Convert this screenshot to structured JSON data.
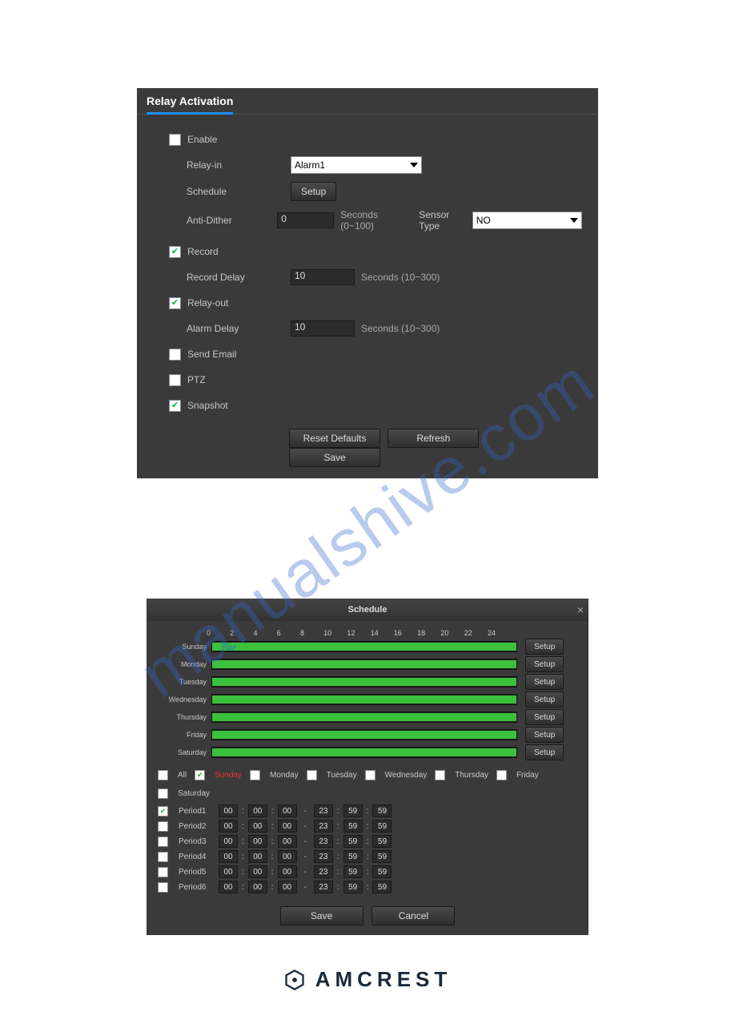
{
  "watermark": "manualshive.com",
  "relay": {
    "title": "Relay Activation",
    "enable": {
      "label": "Enable",
      "checked": false
    },
    "relay_in": {
      "label": "Relay-in",
      "value": "Alarm1"
    },
    "schedule": {
      "label": "Schedule",
      "button": "Setup"
    },
    "anti_dither": {
      "label": "Anti-Dither",
      "value": "0",
      "hint": "Seconds (0~100)"
    },
    "sensor_type": {
      "label": "Sensor Type",
      "value": "NO"
    },
    "record": {
      "label": "Record",
      "checked": true
    },
    "record_delay": {
      "label": "Record Delay",
      "value": "10",
      "hint": "Seconds (10~300)"
    },
    "relay_out": {
      "label": "Relay-out",
      "checked": true
    },
    "alarm_delay": {
      "label": "Alarm Delay",
      "value": "10",
      "hint": "Seconds (10~300)"
    },
    "send_email": {
      "label": "Send Email",
      "checked": false
    },
    "ptz": {
      "label": "PTZ",
      "checked": false
    },
    "snapshot": {
      "label": "Snapshot",
      "checked": true
    },
    "buttons": {
      "reset": "Reset Defaults",
      "refresh": "Refresh",
      "save": "Save"
    }
  },
  "schedule_dialog": {
    "title": "Schedule",
    "hours": [
      "0",
      "2",
      "4",
      "6",
      "8",
      "10",
      "12",
      "14",
      "16",
      "18",
      "20",
      "22",
      "24"
    ],
    "days": [
      "Sunday",
      "Monday",
      "Tuesday",
      "Wednesday",
      "Thursday",
      "Friday",
      "Saturday"
    ],
    "setup_btn": "Setup",
    "day_checks": {
      "all": {
        "label": "All",
        "checked": false
      },
      "sunday": {
        "label": "Sunday",
        "checked": true
      },
      "monday": {
        "label": "Monday",
        "checked": false
      },
      "tuesday": {
        "label": "Tuesday",
        "checked": false
      },
      "wednesday": {
        "label": "Wednesday",
        "checked": false
      },
      "thursday": {
        "label": "Thursday",
        "checked": false
      },
      "friday": {
        "label": "Friday",
        "checked": false
      },
      "saturday": {
        "label": "Saturday",
        "checked": false
      }
    },
    "periods": [
      {
        "name": "Period1",
        "checked": true,
        "from": [
          "00",
          "00",
          "00"
        ],
        "to": [
          "23",
          "59",
          "59"
        ]
      },
      {
        "name": "Period2",
        "checked": false,
        "from": [
          "00",
          "00",
          "00"
        ],
        "to": [
          "23",
          "59",
          "59"
        ]
      },
      {
        "name": "Period3",
        "checked": false,
        "from": [
          "00",
          "00",
          "00"
        ],
        "to": [
          "23",
          "59",
          "59"
        ]
      },
      {
        "name": "Period4",
        "checked": false,
        "from": [
          "00",
          "00",
          "00"
        ],
        "to": [
          "23",
          "59",
          "59"
        ]
      },
      {
        "name": "Period5",
        "checked": false,
        "from": [
          "00",
          "00",
          "00"
        ],
        "to": [
          "23",
          "59",
          "59"
        ]
      },
      {
        "name": "Period6",
        "checked": false,
        "from": [
          "00",
          "00",
          "00"
        ],
        "to": [
          "23",
          "59",
          "59"
        ]
      }
    ],
    "buttons": {
      "save": "Save",
      "cancel": "Cancel"
    }
  },
  "brand": "AMCREST"
}
